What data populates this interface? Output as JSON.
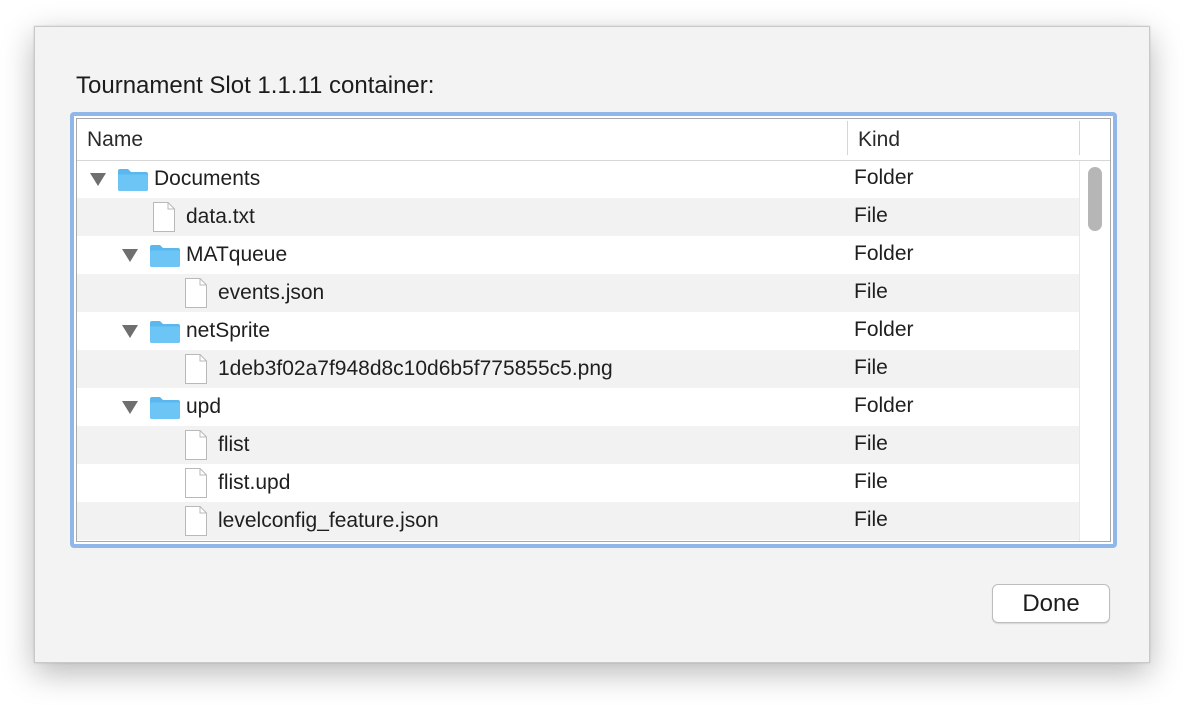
{
  "dialog": {
    "title": "Tournament Slot 1.1.11 container:",
    "done_label": "Done"
  },
  "table": {
    "columns": {
      "name": "Name",
      "kind": "Kind"
    },
    "rows": [
      {
        "name": "Documents",
        "kind": "Folder",
        "type": "folder",
        "level": 0,
        "expanded": true
      },
      {
        "name": "data.txt",
        "kind": "File",
        "type": "file",
        "level": 1
      },
      {
        "name": "MATqueue",
        "kind": "Folder",
        "type": "folder",
        "level": 1,
        "expanded": true
      },
      {
        "name": "events.json",
        "kind": "File",
        "type": "file",
        "level": 2
      },
      {
        "name": "netSprite",
        "kind": "Folder",
        "type": "folder",
        "level": 1,
        "expanded": true
      },
      {
        "name": "1deb3f02a7f948d8c10d6b5f775855c5.png",
        "kind": "File",
        "type": "file",
        "level": 2
      },
      {
        "name": "upd",
        "kind": "Folder",
        "type": "folder",
        "level": 1,
        "expanded": true
      },
      {
        "name": "flist",
        "kind": "File",
        "type": "file",
        "level": 2
      },
      {
        "name": "flist.upd",
        "kind": "File",
        "type": "file",
        "level": 2
      },
      {
        "name": "levelconfig_feature.json",
        "kind": "File",
        "type": "file",
        "level": 2
      }
    ]
  },
  "icons": {
    "folder": "folder-icon",
    "file": "file-icon",
    "disclosure": "disclosure-triangle-icon"
  },
  "colors": {
    "focus_ring": "#8fb7ea",
    "folder_blue": "#6cc5f5",
    "alt_row": "#f2f2f2"
  }
}
